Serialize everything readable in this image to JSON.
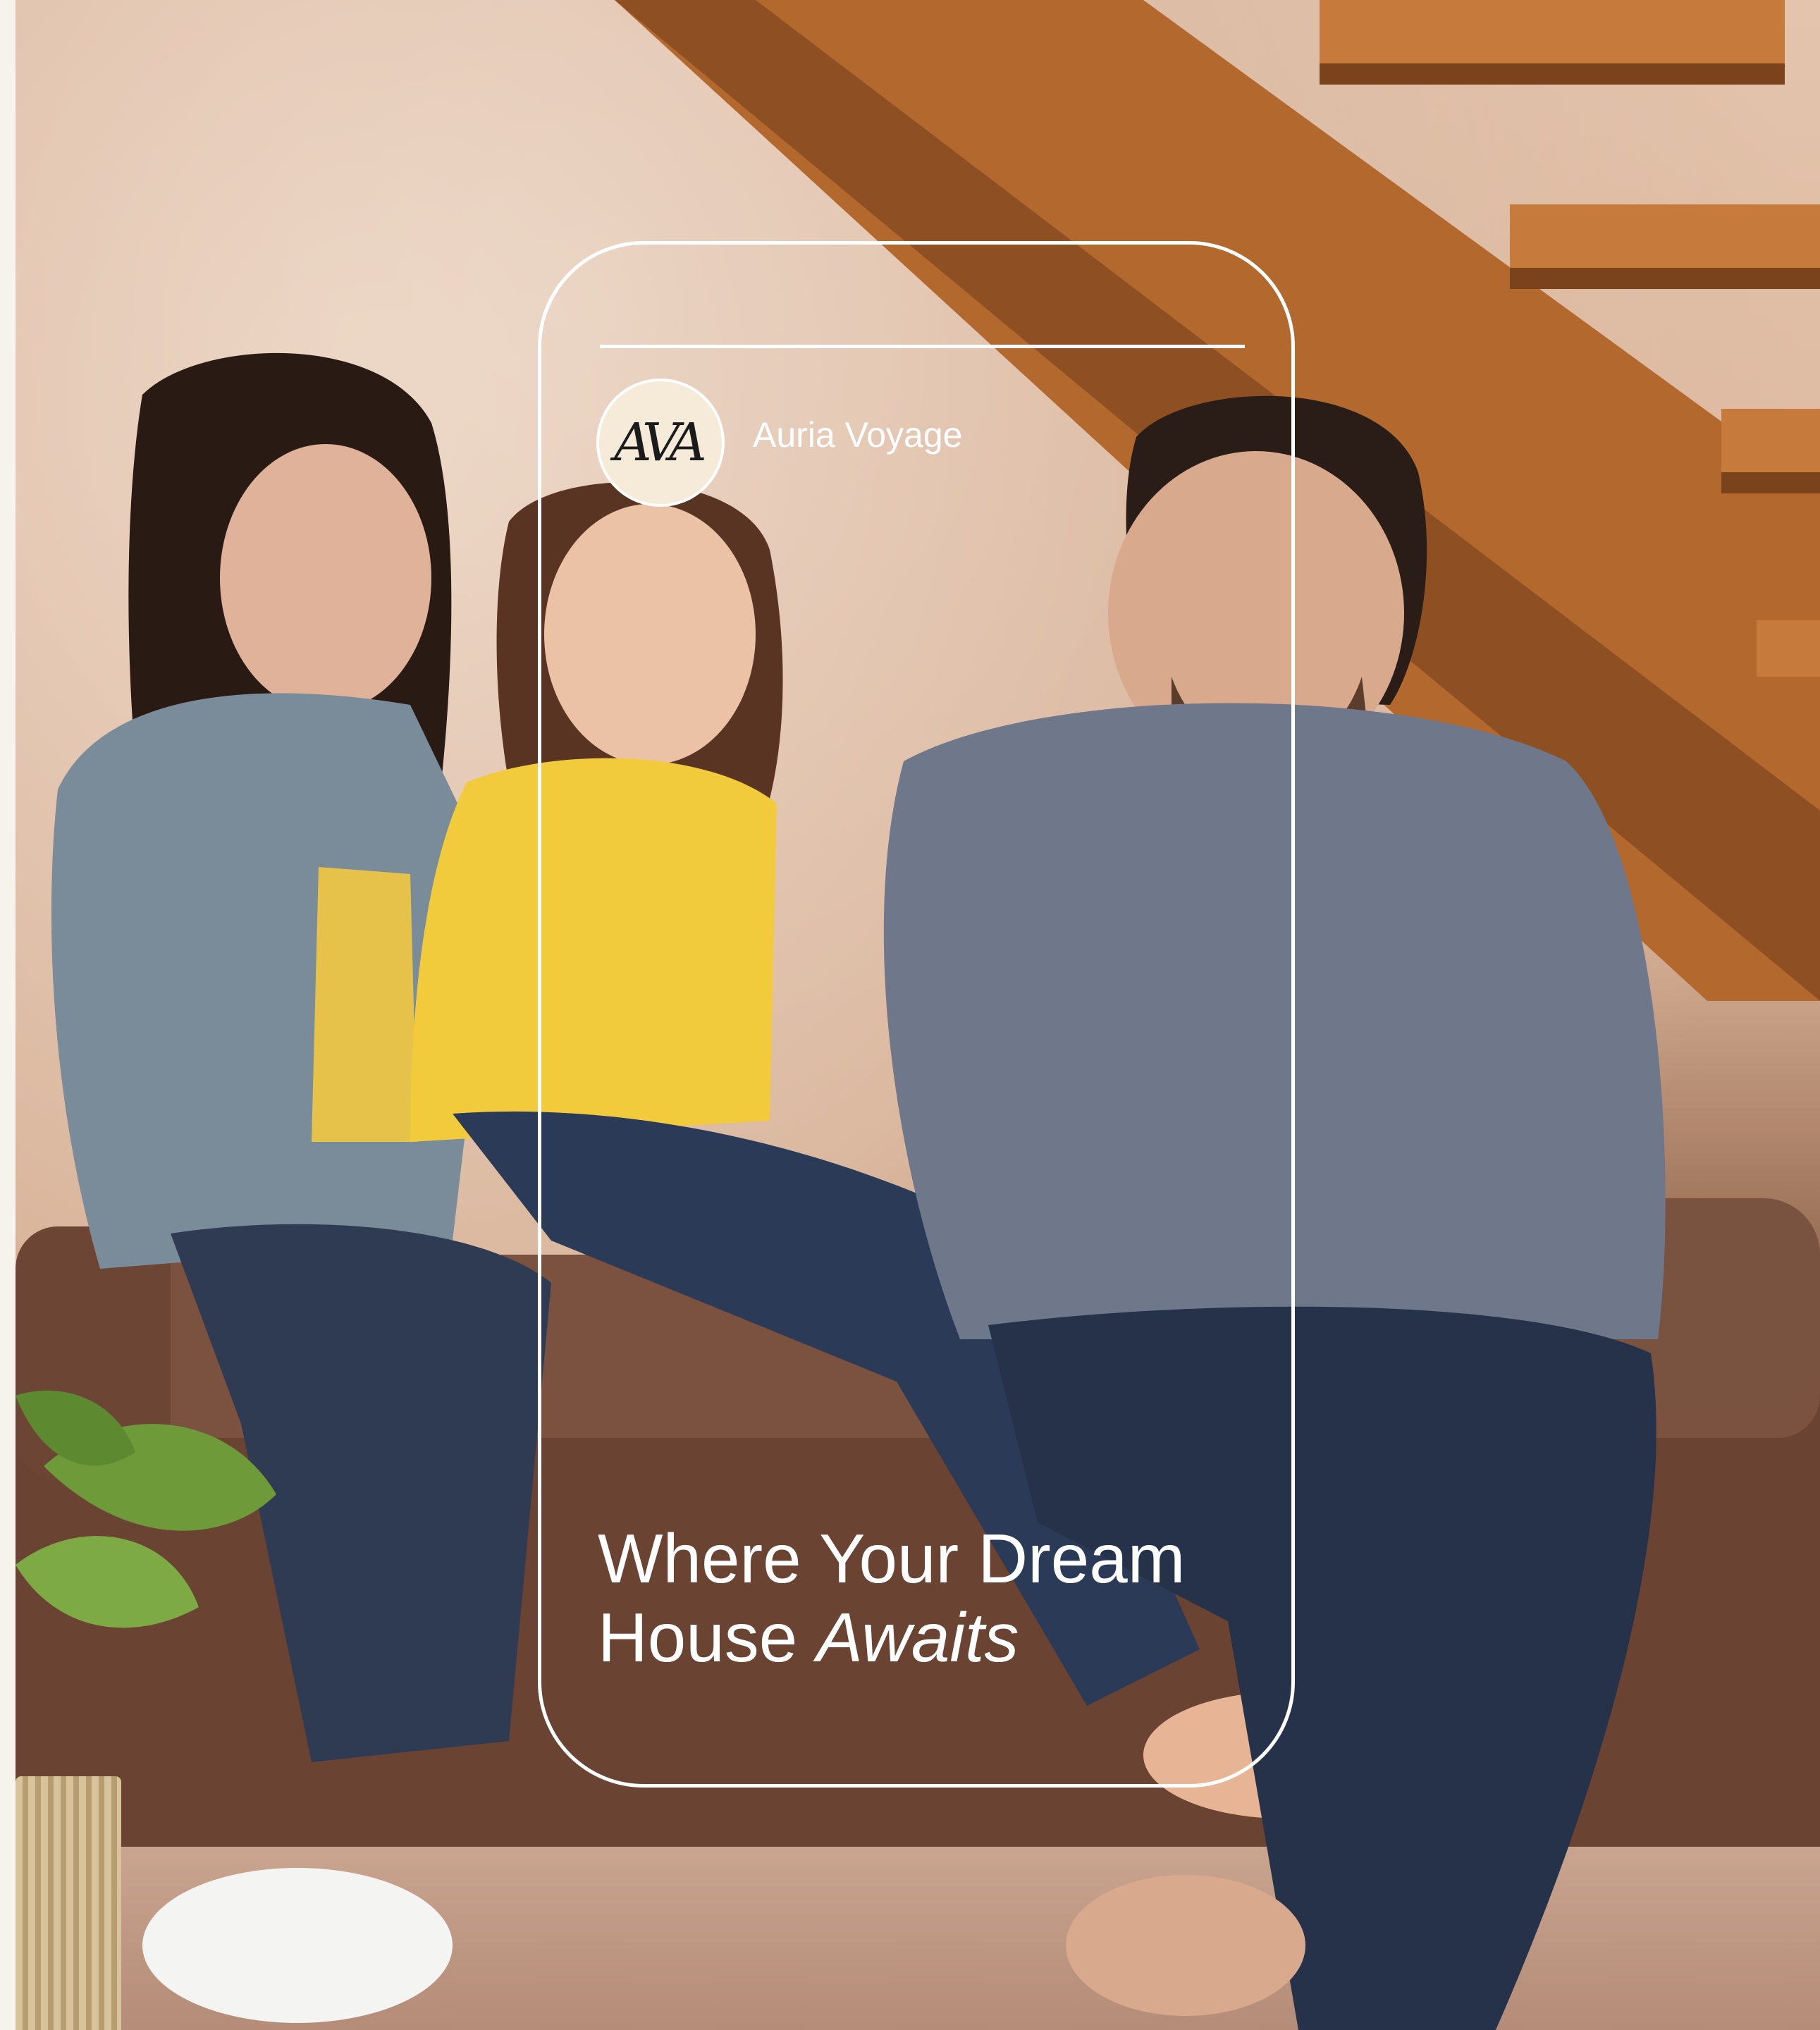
{
  "brand": {
    "logo_text": "AVA",
    "name": "Auria Voyage"
  },
  "hero": {
    "headline_line1": "Where Your Dream",
    "headline_line2_plain": "House ",
    "headline_line2_italic": "Awaits"
  },
  "photo": {
    "subject": "family-on-sofa-photo"
  }
}
